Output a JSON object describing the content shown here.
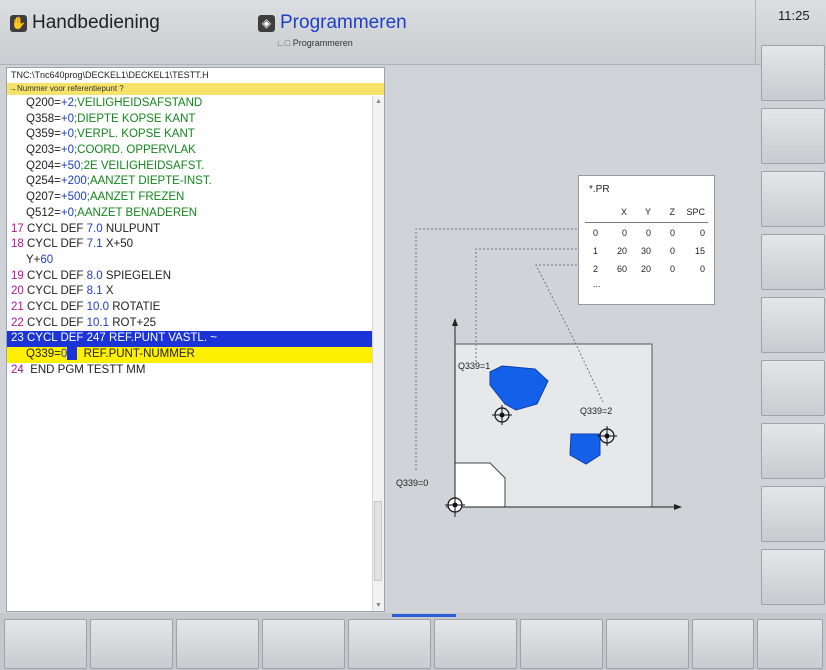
{
  "header": {
    "mode_manual": {
      "icon": "hand-icon",
      "label": "Handbediening"
    },
    "mode_program": {
      "icon": "program-icon",
      "label": "Programmeren",
      "breadcrumb": "Programmeren"
    },
    "clock": "11:25"
  },
  "program": {
    "path": "TNC:\\Tnc640prog\\DECKEL1\\DECKEL1\\TESTT.H",
    "prompt": "→Nummer voor referentiepunt ?",
    "lines": [
      {
        "num": "",
        "cmd": "Q200=",
        "val": "+2",
        "cmt": ";VEILIGHEIDSAFSTAND",
        "indent": true
      },
      {
        "num": "",
        "cmd": "Q358=",
        "val": "+0",
        "cmt": ";DIEPTE KOPSE KANT",
        "indent": true
      },
      {
        "num": "",
        "cmd": "Q359=",
        "val": "+0",
        "cmt": ";VERPL. KOPSE KANT",
        "indent": true
      },
      {
        "num": "",
        "cmd": "Q203=",
        "val": "+0",
        "cmt": ";COORD. OPPERVLAK",
        "indent": true
      },
      {
        "num": "",
        "cmd": "Q204=",
        "val": "+50",
        "cmt": ";2E VEILIGHEIDSAFST.",
        "indent": true
      },
      {
        "num": "",
        "cmd": "Q254=",
        "val": "+200",
        "cmt": ";AANZET DIEPTE-INST.",
        "indent": true
      },
      {
        "num": "",
        "cmd": "Q207=",
        "val": "+500",
        "cmt": ";AANZET FREZEN",
        "indent": true
      },
      {
        "num": "",
        "cmd": "Q512=",
        "val": "+0",
        "cmt": ";AANZET BENADEREN",
        "indent": true
      },
      {
        "num": "17",
        "cmd": "CYCL DEF ",
        "val": "7.0",
        "cmt": " NULPUNT",
        "plain": true
      },
      {
        "num": "18",
        "cmd": "CYCL DEF ",
        "val": "7.1",
        "cmt": " X+50",
        "plain": true
      },
      {
        "num": "",
        "cmd": "Y+",
        "val": "60",
        "cmt": "",
        "indent": true
      },
      {
        "num": "19",
        "cmd": "CYCL DEF ",
        "val": "8.0",
        "cmt": " SPIEGELEN",
        "plain": true
      },
      {
        "num": "20",
        "cmd": "CYCL DEF ",
        "val": "8.1",
        "cmt": " X",
        "plain": true
      },
      {
        "num": "21",
        "cmd": "CYCL DEF ",
        "val": "10.0",
        "cmt": " ROTATIE",
        "plain": true
      },
      {
        "num": "22",
        "cmd": "CYCL DEF ",
        "val": "10.1",
        "cmt": " ROT+25",
        "plain": true
      },
      {
        "num": "23",
        "cmd": "CYCL DEF 247 REF.PUNT VASTL. ~",
        "val": "",
        "cmt": "",
        "selected": "blue"
      },
      {
        "num": "",
        "cmd": "Q339=",
        "val": "0",
        "cmt": "  REF.PUNT-NUMMER",
        "indent": true,
        "selected": "yellow",
        "cursor": true
      },
      {
        "num": "24",
        "cmd": " END PGM TESTT MM",
        "val": "",
        "cmt": "",
        "plain": true
      }
    ]
  },
  "preset_table": {
    "title": "*.PR",
    "columns": [
      "X",
      "Y",
      "Z",
      "SPC"
    ],
    "rows": [
      {
        "id": "0",
        "x": "0",
        "y": "0",
        "z": "0",
        "spc": "0"
      },
      {
        "id": "1",
        "x": "20",
        "y": "30",
        "z": "0",
        "spc": "15"
      },
      {
        "id": "2",
        "x": "60",
        "y": "20",
        "z": "0",
        "spc": "0"
      }
    ],
    "more": "..."
  },
  "diagram": {
    "labels": {
      "q1": "Q339=1",
      "q2": "Q339=2",
      "q0": "Q339=0"
    },
    "colors": {
      "shape": "#1560e8",
      "workpiece": "#e6e8ea"
    }
  },
  "colors": {
    "accent_blue": "#1a34d8",
    "highlight_yellow": "#ffef00",
    "prompt_yellow": "#f7e36a"
  }
}
